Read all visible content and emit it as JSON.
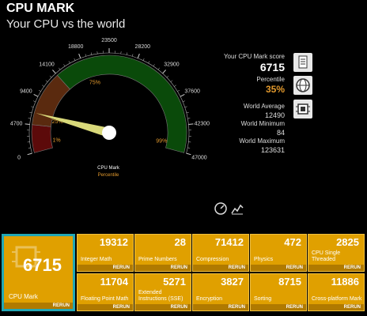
{
  "header": {
    "title": "CPU MARK",
    "subtitle": "Your CPU vs the world"
  },
  "gauge": {
    "min": 0,
    "max": 47000,
    "value": 6715,
    "ticks": [
      "0",
      "4700",
      "9400",
      "14100",
      "18800",
      "23500",
      "28200",
      "32900",
      "37600",
      "42300",
      "47000"
    ],
    "percentile_marks": [
      "1%",
      "25%",
      "75%",
      "99%"
    ],
    "center_label": "CPU Mark",
    "center_sublabel": "Percentile",
    "colors": {
      "green": "#0a4a0a",
      "brown": "#5a2a0f",
      "red": "#5c0a0a",
      "needle": "#d9d97a",
      "orange": "#e39a2d"
    }
  },
  "stats": {
    "score_label": "Your CPU Mark score",
    "score_value": "6715",
    "percentile_label": "Percentile",
    "percentile_value": "35%",
    "avg_label": "World Average",
    "avg_value": "12490",
    "min_label": "World Minimum",
    "min_value": "84",
    "max_label": "World Maximum",
    "max_value": "123631"
  },
  "icons": {
    "side": [
      "document-icon",
      "globe-icon",
      "chip-icon"
    ],
    "bottom": [
      "speedometer-icon",
      "chart-icon"
    ]
  },
  "tiles": {
    "main": {
      "value": "6715",
      "label": "CPU Mark",
      "rerun": "RERUN"
    },
    "row1": [
      {
        "value": "19312",
        "label": "Integer Math",
        "rerun": "RERUN"
      },
      {
        "value": "28",
        "label": "Prime Numbers",
        "rerun": "RERUN"
      },
      {
        "value": "71412",
        "label": "Compression",
        "rerun": "RERUN"
      },
      {
        "value": "472",
        "label": "Physics",
        "rerun": "RERUN"
      },
      {
        "value": "2825",
        "label": "CPU Single Threaded",
        "rerun": "RERUN"
      }
    ],
    "row2": [
      {
        "value": "11704",
        "label": "Floating Point Math",
        "rerun": "RERUN"
      },
      {
        "value": "5271",
        "label": "Extended Instructions (SSE)",
        "rerun": "RERUN"
      },
      {
        "value": "3827",
        "label": "Encryption",
        "rerun": "RERUN"
      },
      {
        "value": "8715",
        "label": "Sorting",
        "rerun": "RERUN"
      },
      {
        "value": "11886",
        "label": "Cross-platform Mark",
        "rerun": "RERUN"
      }
    ]
  }
}
